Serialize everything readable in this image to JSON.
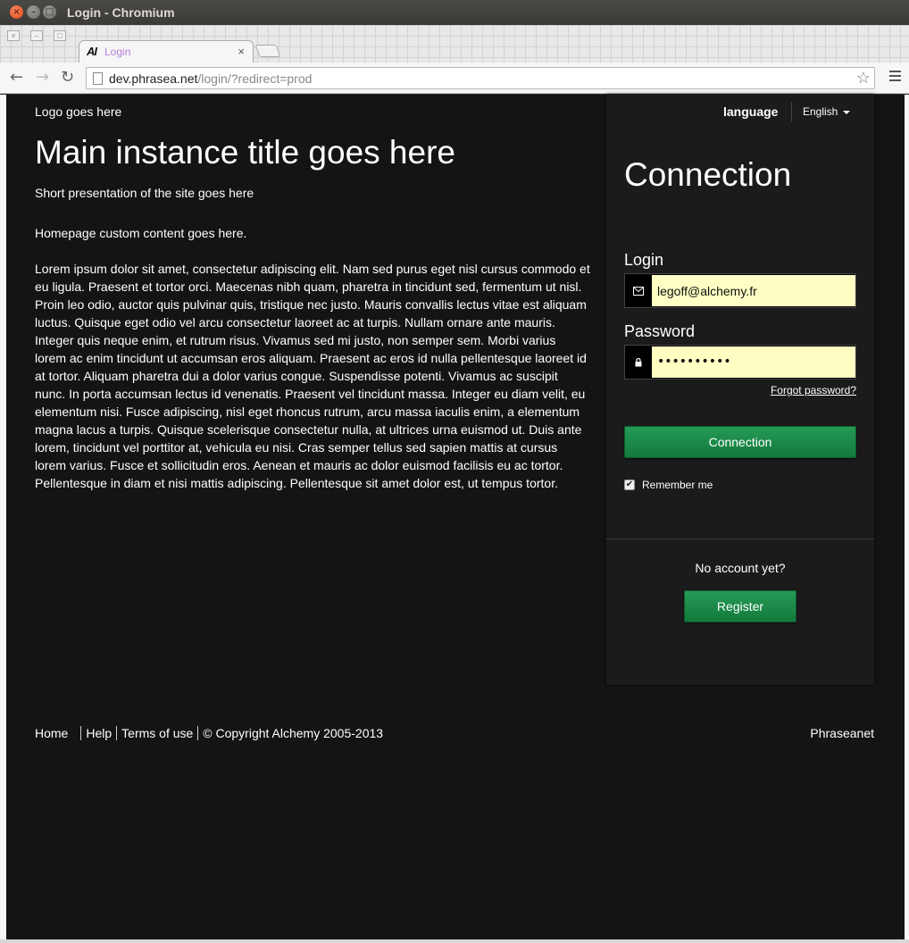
{
  "window": {
    "title": "Login - Chromium",
    "close_glyph": "×",
    "min_glyph": "–",
    "max_glyph": "□"
  },
  "tab": {
    "logo": "AI",
    "label": "Login",
    "close_glyph": "×"
  },
  "toolbar": {
    "back_glyph": "←",
    "forward_glyph": "→",
    "reload_glyph": "↻",
    "url_host": "dev.phrasea.net",
    "url_path": "/login/?redirect=prod",
    "star_glyph": "☆"
  },
  "page": {
    "logo_text": "Logo goes here",
    "main_title": "Main instance title goes here",
    "short_presentation": "Short presentation of the site goes here",
    "custom_content": "Homepage custom content goes here.",
    "lorem": "Lorem ipsum dolor sit amet, consectetur adipiscing elit. Nam sed purus eget nisl cursus commodo et eu ligula. Praesent et tortor orci. Maecenas nibh quam, pharetra in tincidunt sed, fermentum ut nisl. Proin leo odio, auctor quis pulvinar quis, tristique nec justo. Mauris convallis lectus vitae est aliquam luctus. Quisque eget odio vel arcu consectetur laoreet ac at turpis. Nullam ornare ante mauris. Integer quis neque enim, et rutrum risus. Vivamus sed mi justo, non semper sem. Morbi varius lorem ac enim tincidunt ut accumsan eros aliquam. Praesent ac eros id nulla pellentesque laoreet id at tortor. Aliquam pharetra dui a dolor varius congue. Suspendisse potenti. Vivamus ac suscipit nunc. In porta accumsan lectus id venenatis. Praesent vel tincidunt massa. Integer eu diam velit, eu elementum nisi. Fusce adipiscing, nisl eget rhoncus rutrum, arcu massa iaculis enim, a elementum magna lacus a turpis. Quisque scelerisque consectetur nulla, at ultrices urna euismod ut. Duis ante lorem, tincidunt vel porttitor at, vehicula eu nisi. Cras semper tellus sed sapien mattis at cursus lorem varius. Fusce et sollicitudin eros. Aenean et mauris ac dolor euismod facilisis eu ac tortor. Pellentesque in diam et nisi mattis adipiscing. Pellentesque sit amet dolor est, ut tempus tortor."
  },
  "panel": {
    "language_label": "language",
    "language_selected": "English",
    "title": "Connection",
    "login_label": "Login",
    "login_value": "legoff@alchemy.fr",
    "password_label": "Password",
    "password_mask": "••••••••••",
    "forgot_password": "Forgot password?",
    "connection_button": "Connection",
    "remember_me": "Remember me",
    "remember_checked": true,
    "no_account": "No account yet?",
    "register_button": "Register",
    "mail_glyph": "✉",
    "lock_glyph": "🔒",
    "check_glyph": "✔"
  },
  "footer": {
    "home": "Home",
    "help": "Help",
    "terms": "Terms of use",
    "copyright": "© Copyright Alchemy 2005-2013",
    "brand": "Phraseanet"
  },
  "colors": {
    "page_bg": "#141414",
    "panel_bg": "#1b1b1b",
    "button_green": "#1e8a4a",
    "input_bg": "#ffffc4",
    "tab_label": "#b37ed8"
  }
}
